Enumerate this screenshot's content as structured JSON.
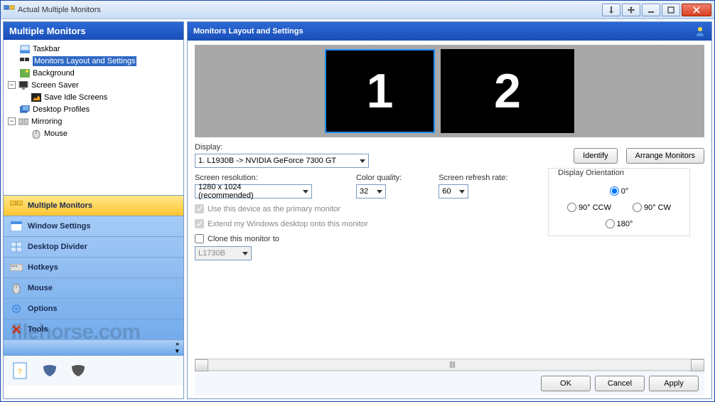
{
  "window": {
    "title": "Actual Multiple Monitors"
  },
  "sidebar": {
    "header": "Multiple Monitors",
    "tree": [
      {
        "label": "Taskbar"
      },
      {
        "label": "Monitors Layout and Settings",
        "selected": true
      },
      {
        "label": "Background"
      },
      {
        "label": "Screen Saver",
        "expandable": true
      },
      {
        "label": "Save Idle Screens"
      },
      {
        "label": "Desktop Profiles"
      },
      {
        "label": "Mirroring",
        "expandable": true
      },
      {
        "label": "Mouse"
      }
    ],
    "nav": [
      {
        "label": "Multiple Monitors",
        "active": true
      },
      {
        "label": "Window Settings"
      },
      {
        "label": "Desktop Divider"
      },
      {
        "label": "Hotkeys"
      },
      {
        "label": "Mouse"
      },
      {
        "label": "Options"
      },
      {
        "label": "Tools"
      }
    ]
  },
  "main": {
    "header": "Monitors Layout and Settings",
    "monitors": {
      "m1": "1",
      "m2": "2"
    },
    "display_label": "Display:",
    "display_value": "1. L1930B -> NVIDIA GeForce 7300 GT",
    "identify_btn": "Identify",
    "arrange_btn": "Arrange Monitors",
    "resolution_label": "Screen resolution:",
    "resolution_value": "1280 x 1024 (recommended)",
    "colorq_label": "Color quality:",
    "colorq_value": "32",
    "refresh_label": "Screen refresh rate:",
    "refresh_value": "60",
    "orientation_label": "Display Orientation",
    "orient": {
      "o0": "0°",
      "o90ccw": "90° CCW",
      "o90cw": "90° CW",
      "o180": "180°"
    },
    "use_primary": "Use this device as the primary monitor",
    "extend_desktop": "Extend my Windows desktop onto this monitor",
    "clone_label": "Clone this monitor to",
    "clone_value": "L1730B"
  },
  "buttons": {
    "ok": "OK",
    "cancel": "Cancel",
    "apply": "Apply"
  },
  "watermark": "filehorse.com"
}
